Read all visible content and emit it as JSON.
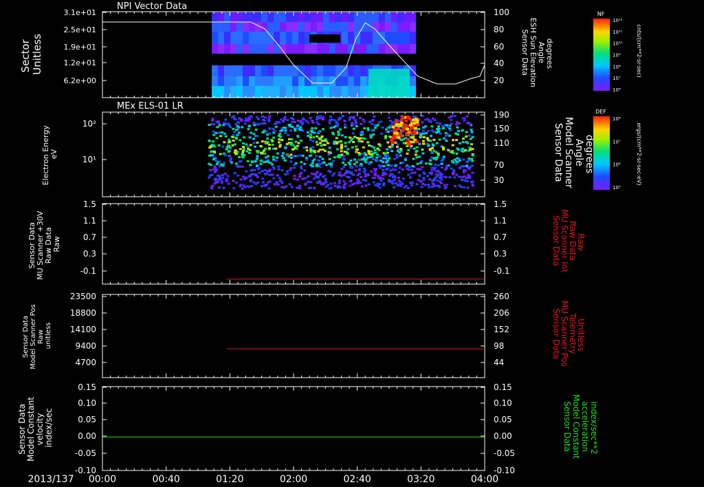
{
  "date_label": "2013/137",
  "time_ticks": [
    "00:00",
    "00:40",
    "01:20",
    "02:00",
    "02:40",
    "03:20",
    "04:00"
  ],
  "colors": {
    "red": "#e8141b",
    "green": "#19e619",
    "white": "#ffffff"
  },
  "panels": {
    "p1": {
      "title": "NPI Vector Data",
      "ylabel_lines": [
        "Sector",
        "Unitless"
      ],
      "y_ticks": [
        "3.1e+01",
        "2.5e+01",
        "1.9e+01",
        "1.2e+01",
        "6.2e+00"
      ],
      "right_ticks": [
        "100",
        "80",
        "60",
        "40",
        "20"
      ],
      "right_label_lines": [
        "Sensor Data",
        "ESH Sun Elevation",
        "Angle",
        "degrees"
      ],
      "colorbar": {
        "title": "NF",
        "ticks": [
          "10¹²",
          "10¹¹",
          "10¹⁰",
          "10⁹",
          "10⁸",
          "10⁷",
          "10⁶"
        ],
        "units": "cnts/(cm**2-sr-sec)"
      }
    },
    "p2": {
      "title": "MEx ELS-01 LR",
      "ylabel_lines": [
        "Electron Energy",
        "eV"
      ],
      "y_ticks": [
        "10²",
        "10¹"
      ],
      "right_ticks": [
        "190",
        "150",
        "110",
        "70",
        "30"
      ],
      "right_label_lines": [
        "Sensor Data",
        "Model Scanner",
        "Angle",
        "degrees"
      ],
      "colorbar": {
        "title": "DEF",
        "ticks": [
          "10⁸",
          "10⁷",
          "10⁶",
          "10⁵"
        ],
        "units": "ergs/(cm**2-sr-sec-eV)"
      }
    },
    "p3": {
      "ylabel_lines": [
        "Sensor Data",
        "MU Scanner +30V",
        "Raw Data",
        "Raw"
      ],
      "y_ticks": [
        "1.5",
        "1.1",
        "0.7",
        "0.3",
        "-0.1"
      ],
      "right_ticks": [
        "1.5",
        "1.1",
        "0.7",
        "0.3",
        "-0.1"
      ],
      "right_label_lines": [
        "Sensor Data",
        "MU Scanner Int",
        "Raw Data",
        "Raw"
      ]
    },
    "p4": {
      "ylabel_lines": [
        "Sensor Data",
        "Model Scanner Pos",
        "Raw",
        "unitless"
      ],
      "y_ticks": [
        "23500",
        "18800",
        "14100",
        "9400",
        "4700"
      ],
      "right_ticks": [
        "260",
        "206",
        "152",
        "98",
        "44"
      ],
      "right_label_lines": [
        "Sensor Data",
        "MU Scanner Pos",
        "Telemetry",
        "Unitless"
      ]
    },
    "p5": {
      "ylabel_lines": [
        "Sensor Data",
        "Model Constant",
        "velocity",
        "index/sec"
      ],
      "y_ticks": [
        "0.15",
        "0.10",
        "0.05",
        "0.00",
        "-0.05",
        "-0.10"
      ],
      "right_ticks": [
        "0.15",
        "0.10",
        "0.05",
        "0.00",
        "-0.05",
        "-0.10"
      ],
      "right_label_lines": [
        "Sensor Data",
        "Model Constant",
        "acceleration",
        "index/sec**2"
      ]
    }
  },
  "chart_data": [
    {
      "type": "heatmap",
      "title": "NPI Vector Data",
      "x_range": [
        "00:00",
        "04:00"
      ],
      "ylabel": "Sector Unitless",
      "data_coverage": [
        "01:17",
        "03:18"
      ],
      "overlay_series": {
        "name": "Sensor Data ESH Sun Elevation Angle degrees",
        "x_hours": [
          0,
          1.2,
          1.55,
          1.7,
          1.85,
          2.0,
          2.2,
          2.4,
          2.55,
          2.65,
          2.75,
          2.85,
          3.05,
          3.3,
          3.5,
          3.7,
          3.85,
          3.95,
          4.0
        ],
        "y": [
          88,
          88,
          88,
          80,
          60,
          38,
          17,
          17,
          35,
          68,
          87,
          80,
          55,
          25,
          16,
          16,
          22,
          25,
          38
        ],
        "ylim": [
          0,
          100
        ]
      }
    },
    {
      "type": "heatmap",
      "title": "MEx ELS-01 LR",
      "x_range": [
        "00:00",
        "04:00"
      ],
      "ylabel": "Electron Energy eV",
      "y_scale": "log",
      "data_coverage": [
        "01:15",
        "03:49"
      ],
      "overlay_series": {
        "name": "Sensor Data Model Scanner Angle degrees",
        "x_hours": [
          0,
          4.0
        ],
        "y": [
          10,
          10
        ],
        "ylim": [
          10,
          190
        ]
      }
    },
    {
      "type": "line",
      "x_range": [
        "00:00",
        "04:00"
      ],
      "ylim": [
        -0.1,
        1.5
      ],
      "series": [
        {
          "name": "Sensor Data MU Scanner Int Raw Data Raw",
          "x_hours": [
            1.3,
            4.0
          ],
          "y": [
            0.0,
            0.0
          ],
          "color": "#e8141b"
        }
      ]
    },
    {
      "type": "line",
      "x_range": [
        "00:00",
        "04:00"
      ],
      "ylim": [
        0,
        23500
      ],
      "y2lim": [
        0,
        260
      ],
      "series": [
        {
          "name": "Sensor Data MU Scanner Pos Telemetry Unitless",
          "x_hours": [
            1.3,
            4.0
          ],
          "y": [
            90,
            90
          ],
          "axis": "right",
          "color": "#e8141b"
        }
      ]
    },
    {
      "type": "line",
      "x_range": [
        "00:00",
        "04:00"
      ],
      "ylim": [
        -0.1,
        0.15
      ],
      "series": [
        {
          "name": "Sensor Data Model Constant acceleration index/sec**2",
          "x_hours": [
            0,
            4.0
          ],
          "y": [
            0.0,
            0.0
          ],
          "color": "#19e619"
        }
      ]
    }
  ]
}
